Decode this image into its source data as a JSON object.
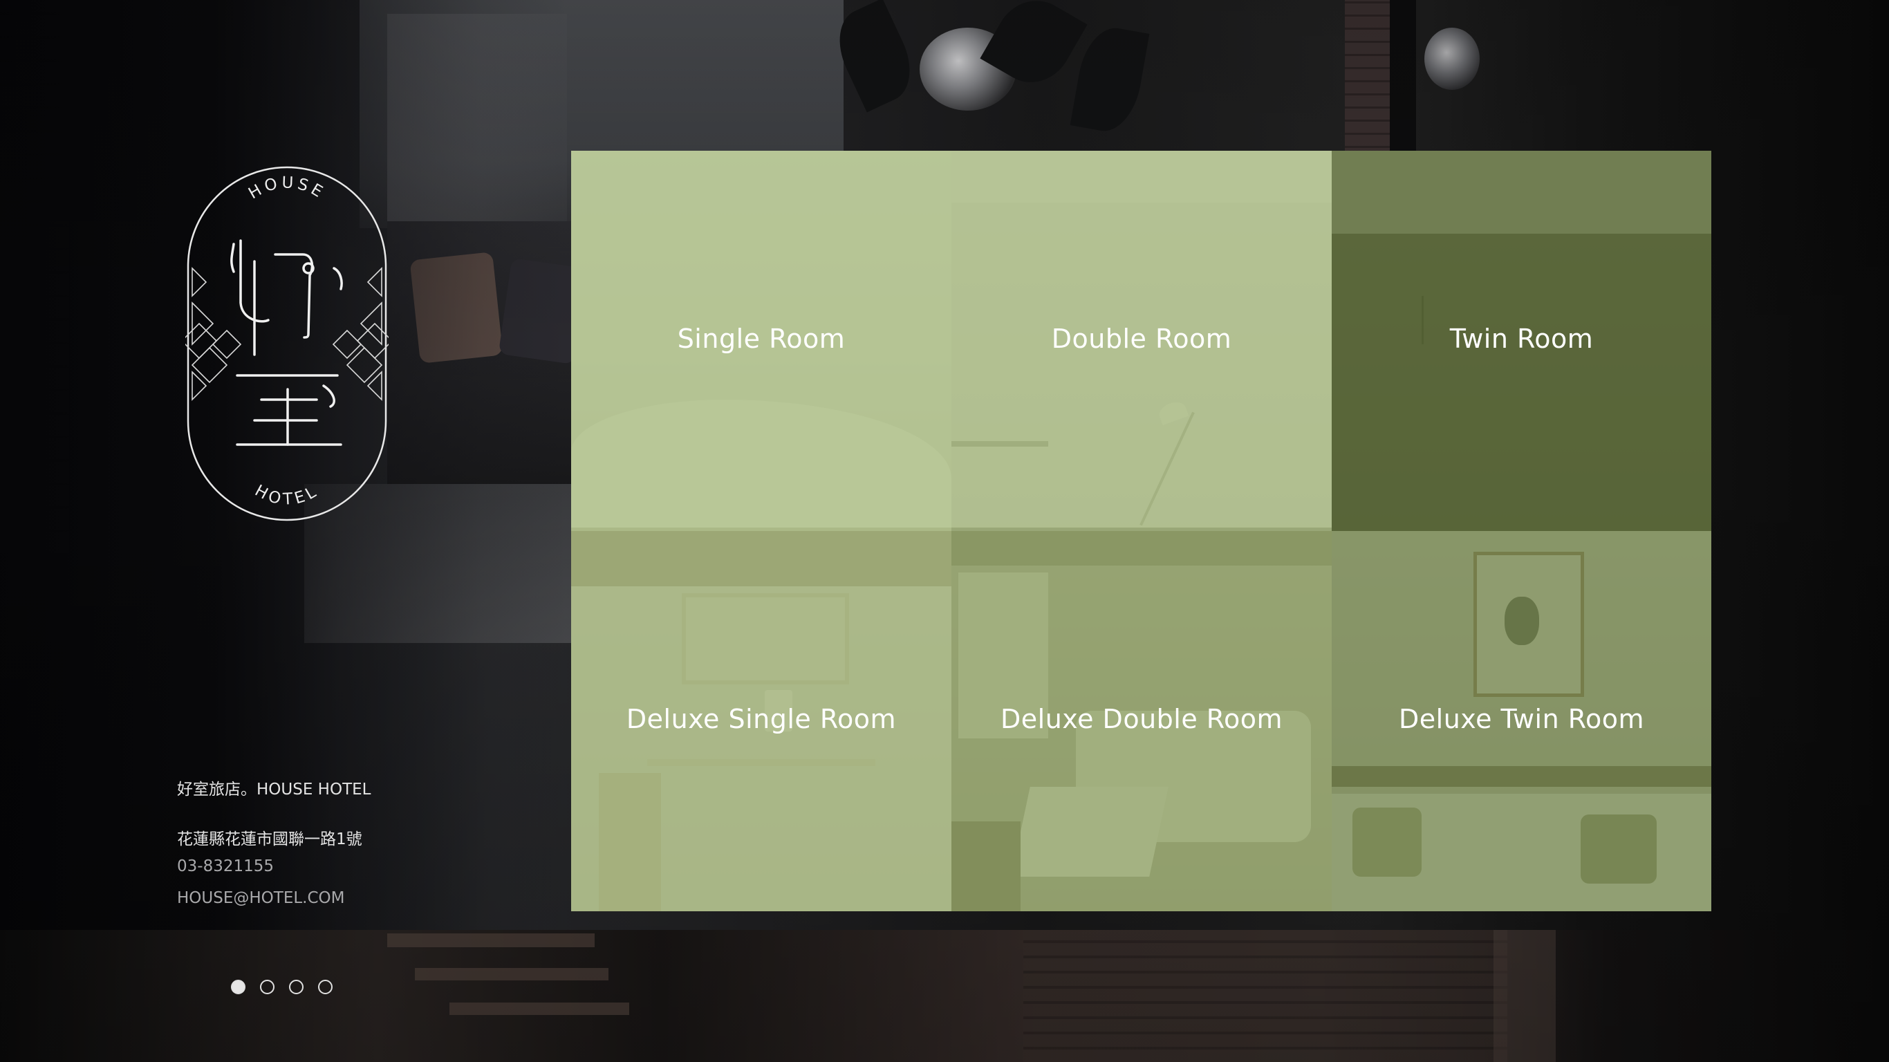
{
  "brand": {
    "logo_top_text": "HOUSE",
    "logo_bottom_text": "HOTEL"
  },
  "contact": {
    "name": "好室旅店。HOUSE HOTEL",
    "address": "花蓮縣花蓮市國聯一路1號",
    "phone": "03-8321155",
    "email": "HOUSE@HOTEL.COM"
  },
  "pagination": {
    "count": 4,
    "active_index": 0
  },
  "rooms": [
    {
      "label": "Single Room"
    },
    {
      "label": "Double Room"
    },
    {
      "label": "Twin Room"
    },
    {
      "label": "Deluxe Single Room"
    },
    {
      "label": "Deluxe Double Room"
    },
    {
      "label": "Deluxe Twin Room"
    }
  ],
  "colors": {
    "tile_tint_light": "#a8ba80",
    "tile_tint_dark": "#586832",
    "text_primary": "#ffffff",
    "text_muted": "#a9a9ab"
  }
}
